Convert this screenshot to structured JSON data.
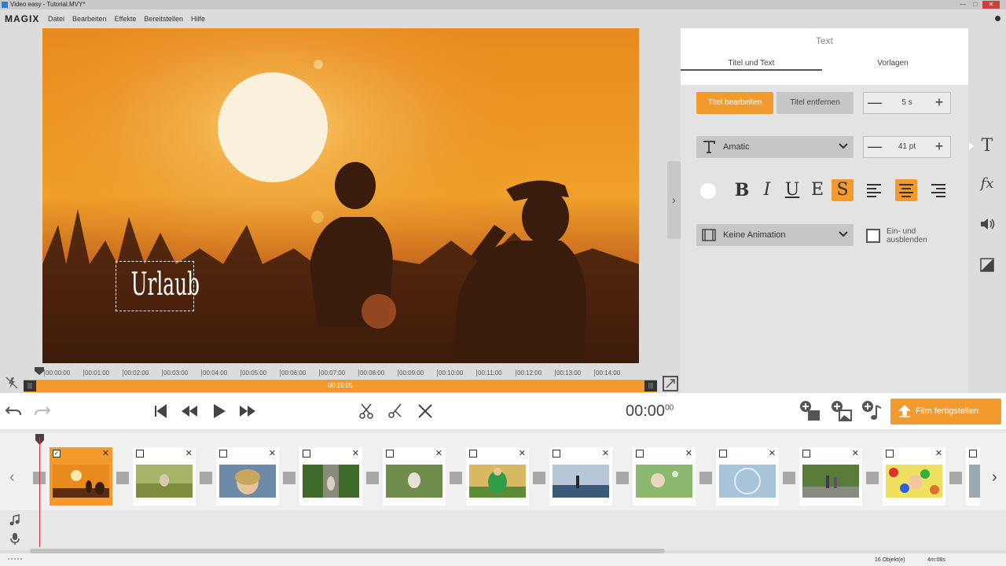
{
  "window": {
    "title": "Video easy - Tutorial.MVY*"
  },
  "app": {
    "logo": "MAGIX"
  },
  "menu": [
    "Datei",
    "Bearbeiten",
    "Effekte",
    "Bereitstellen",
    "Hilfe"
  ],
  "preview": {
    "title_text": "Urlaub"
  },
  "ruler": {
    "ticks": [
      "00:00:00",
      "00:01:00",
      "00:02:00",
      "00:03:00",
      "00:04:00",
      "00:05:00",
      "00:06:00",
      "00:07:00",
      "00:08:00",
      "00:09:00",
      "00:10:00",
      "00:11:00",
      "00:12:00",
      "00:13:00",
      "00:14:00"
    ],
    "duration": "00:15:05"
  },
  "panel": {
    "title": "Text",
    "tabs": [
      "Titel und Text",
      "Vorlagen"
    ],
    "edit_title_button": "Titel bearbeiten",
    "remove_title_button": "Titel entfernen",
    "duration_value": "5 s",
    "font_name": "Amatic",
    "font_size": "41 pt",
    "animation": "Keine Animation",
    "fade_label": "Ein- und ausblenden",
    "fade_checked": false
  },
  "toolbar": {
    "timecode": "00:00",
    "timecode_frames": "00",
    "finish_button": "Film fertigstellen"
  },
  "timeline": {
    "clips": [
      {
        "name": "sunset",
        "selected": true,
        "checked": true
      },
      {
        "name": "girl-meadow",
        "selected": false,
        "checked": false
      },
      {
        "name": "girl-blonde",
        "selected": false,
        "checked": false
      },
      {
        "name": "boy-path",
        "selected": false,
        "checked": false
      },
      {
        "name": "child-grass",
        "selected": false,
        "checked": false
      },
      {
        "name": "boy-green",
        "selected": false,
        "checked": false
      },
      {
        "name": "fishing",
        "selected": false,
        "checked": false
      },
      {
        "name": "bubbles-girl",
        "selected": false,
        "checked": false
      },
      {
        "name": "bubble",
        "selected": false,
        "checked": false
      },
      {
        "name": "park-walk",
        "selected": false,
        "checked": false
      },
      {
        "name": "ball-pit",
        "selected": false,
        "checked": false
      }
    ]
  },
  "status": {
    "objects": "16 Objekt(e)",
    "length": "4m:08s"
  },
  "colors": {
    "accent": "#f29a2e",
    "panel_bg": "#e3e3e3",
    "playhead": "#d03030"
  }
}
